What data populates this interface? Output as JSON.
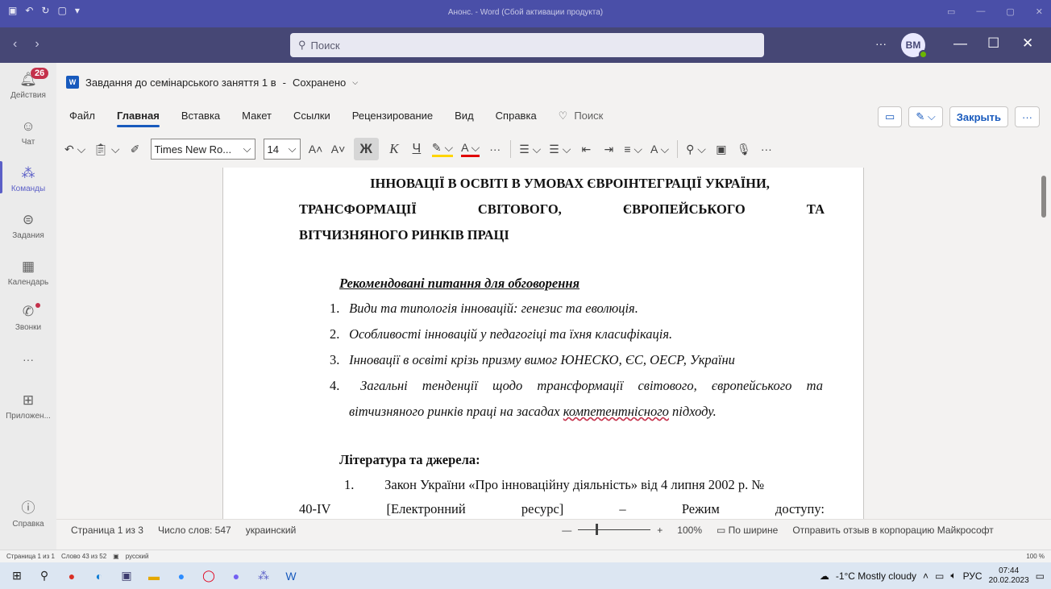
{
  "word_window": {
    "title": "Анонс. - Word (Сбой активации продукта)"
  },
  "teams": {
    "search_placeholder": "Поиск",
    "more": "···",
    "avatar_initials": "BM",
    "rail": {
      "activity_label": "Действия",
      "activity_badge": "26",
      "chat_label": "Чат",
      "teams_label": "Команды",
      "assignments_label": "Задания",
      "calendar_label": "Календарь",
      "calls_label": "Звонки",
      "more_dots": "···",
      "apps_label": "Приложен...",
      "help_label": "Справка"
    }
  },
  "word_online": {
    "doc_title": "Завдання до семінарського заняття 1 в",
    "saved_status": "Сохранено",
    "tabs": [
      "Файл",
      "Главная",
      "Вставка",
      "Макет",
      "Ссылки",
      "Рецензирование",
      "Вид",
      "Справка"
    ],
    "active_tab": "Главная",
    "search_label": "Поиск",
    "close_button": "Закрыть",
    "font_name": "Times New Ro...",
    "font_size": "14",
    "bold_glyph": "Ж",
    "italic_glyph": "К",
    "underline_glyph": "Ч",
    "status": {
      "page": "Страница 1 из 3",
      "words": "Число слов: 547",
      "language": "украинский",
      "zoom": "100%",
      "fit": "По ширине",
      "feedback": "Отправить отзыв в корпорацию Майкрософт"
    }
  },
  "document": {
    "heading_line1": "ІННОВАЦІЇ В ОСВІТІ В УМОВАХ ЄВРОІНТЕГРАЦІЇ УКРАЇНИ,",
    "heading_line2_words": [
      "ТРАНСФОРМАЦІЇ",
      "СВІТОВОГО,",
      "ЄВРОПЕЙСЬКОГО",
      "ТА"
    ],
    "heading_line3": "ВІТЧИЗНЯНОГО РИНКІВ ПРАЦІ",
    "recommended": "Рекомендовані питання для обговорення",
    "questions": [
      {
        "n": "1.",
        "text": "Види та типологія інновацій: генезис та еволюція."
      },
      {
        "n": "2.",
        "text": "Особливості інновацій у педагогіці та їхня класифікація."
      },
      {
        "n": "3.",
        "text": "Інновації в освіті крізь призму вимог ЮНЕСКО, ЄС, ОЕСР, України"
      },
      {
        "n": "4.",
        "text_words": [
          "Загальні",
          "тенденції",
          "щодо",
          "трансформації",
          "світового,",
          "європейського",
          "та"
        ]
      }
    ],
    "q4_cont_before": "вітчизняного ринків праці на засадах ",
    "q4_cont_squiggle": "компетентнісного",
    "q4_cont_after": " підходу.",
    "literature": "Література та джерела:",
    "lit1_n": "1.",
    "lit1": "Закон України «Про інноваційну діяльність» від 4 липня 2002 р. №",
    "lit2_words": [
      "40-IV",
      "[Електронний",
      "ресурс]",
      "–",
      "Режим",
      "доступу:"
    ]
  },
  "desktop_status": {
    "page": "Страница 1 из 1",
    "words": "Слово 43 из 52",
    "language": "русский",
    "zoom": "100 %"
  },
  "taskbar": {
    "weather": "-1°C Mostly cloudy",
    "lang": "РУС",
    "time": "07:44",
    "date": "20.02.2023"
  }
}
